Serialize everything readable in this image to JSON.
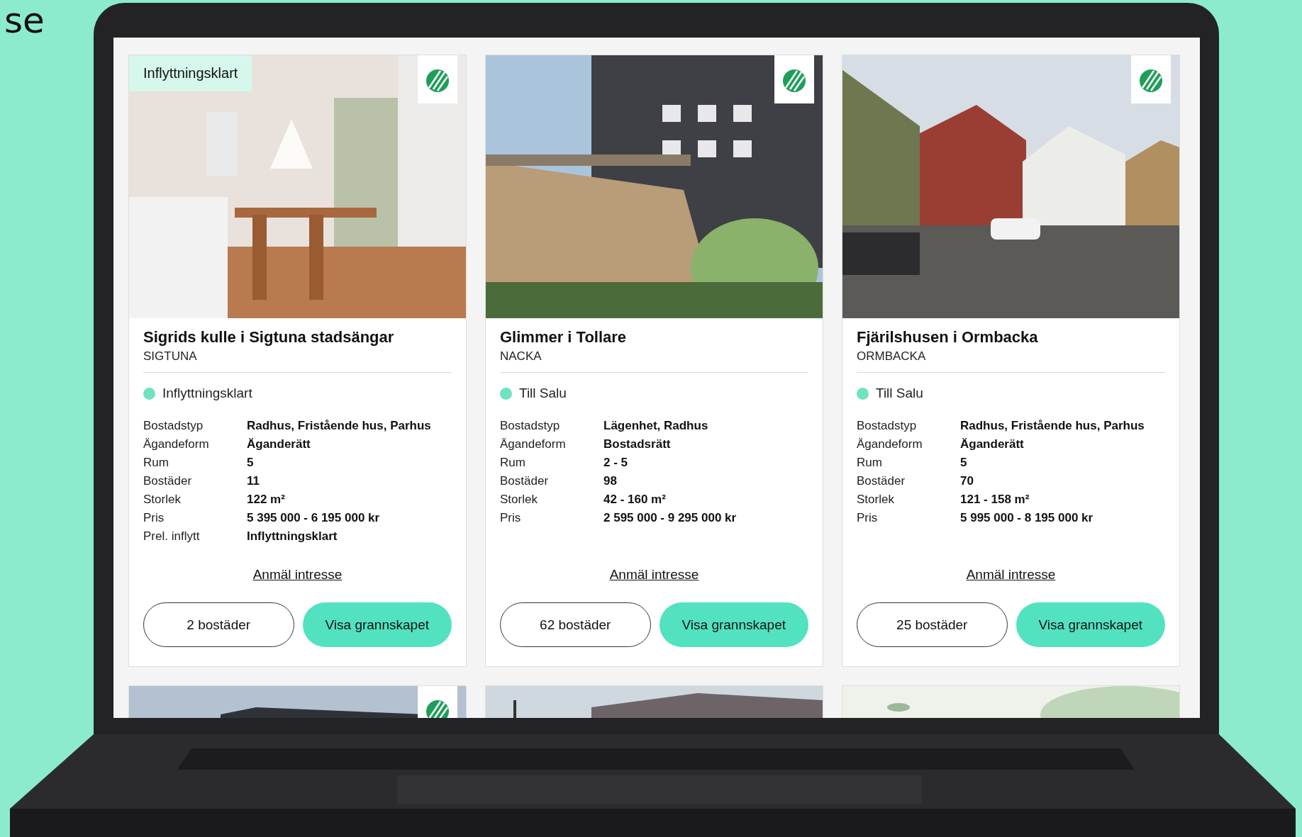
{
  "caption": "se",
  "cards": [
    {
      "tag": "Inflyttningsklart",
      "eco_label": true,
      "title": "Sigrids kulle i Sigtuna stadsängar",
      "area": "SIGTUNA",
      "status": "Inflyttningsklart",
      "specs": [
        {
          "label": "Bostadstyp",
          "value": "Radhus, Fristående hus, Parhus"
        },
        {
          "label": "Ägandeform",
          "value": "Äganderätt"
        },
        {
          "label": "Rum",
          "value": "5"
        },
        {
          "label": "Bostäder",
          "value": "11"
        },
        {
          "label": "Storlek",
          "value": "122 m²"
        },
        {
          "label": "Pris",
          "value": "5 395 000 - 6 195 000 kr"
        },
        {
          "label": "Prel. inflytt",
          "value": "Inflyttningsklart"
        }
      ],
      "link": "Anmäl intresse",
      "homes_button": "2 bostäder",
      "area_button": "Visa grannskapet"
    },
    {
      "eco_label": true,
      "title": "Glimmer i Tollare",
      "area": "NACKA",
      "status": "Till Salu",
      "specs": [
        {
          "label": "Bostadstyp",
          "value": "Lägenhet, Radhus"
        },
        {
          "label": "Ägandeform",
          "value": "Bostadsrätt"
        },
        {
          "label": "Rum",
          "value": "2 - 5"
        },
        {
          "label": "Bostäder",
          "value": "98"
        },
        {
          "label": "Storlek",
          "value": "42 - 160 m²"
        },
        {
          "label": "Pris",
          "value": "2 595 000 - 9 295 000 kr"
        }
      ],
      "link": "Anmäl intresse",
      "homes_button": "62 bostäder",
      "area_button": "Visa grannskapet"
    },
    {
      "eco_label": true,
      "title": "Fjärilshusen i Ormbacka",
      "area": "ORMBACKA",
      "status": "Till Salu",
      "specs": [
        {
          "label": "Bostadstyp",
          "value": "Radhus, Fristående hus, Parhus"
        },
        {
          "label": "Ägandeform",
          "value": "Äganderätt"
        },
        {
          "label": "Rum",
          "value": "5"
        },
        {
          "label": "Bostäder",
          "value": "70"
        },
        {
          "label": "Storlek",
          "value": "121 - 158 m²"
        },
        {
          "label": "Pris",
          "value": "5 995 000 - 8 195 000 kr"
        }
      ],
      "link": "Anmäl intresse",
      "homes_button": "25 bostäder",
      "area_button": "Visa grannskapet"
    }
  ],
  "more_cards": [
    {
      "eco_label": true
    },
    {
      "eco_label": false
    },
    {
      "eco_label": false
    }
  ]
}
